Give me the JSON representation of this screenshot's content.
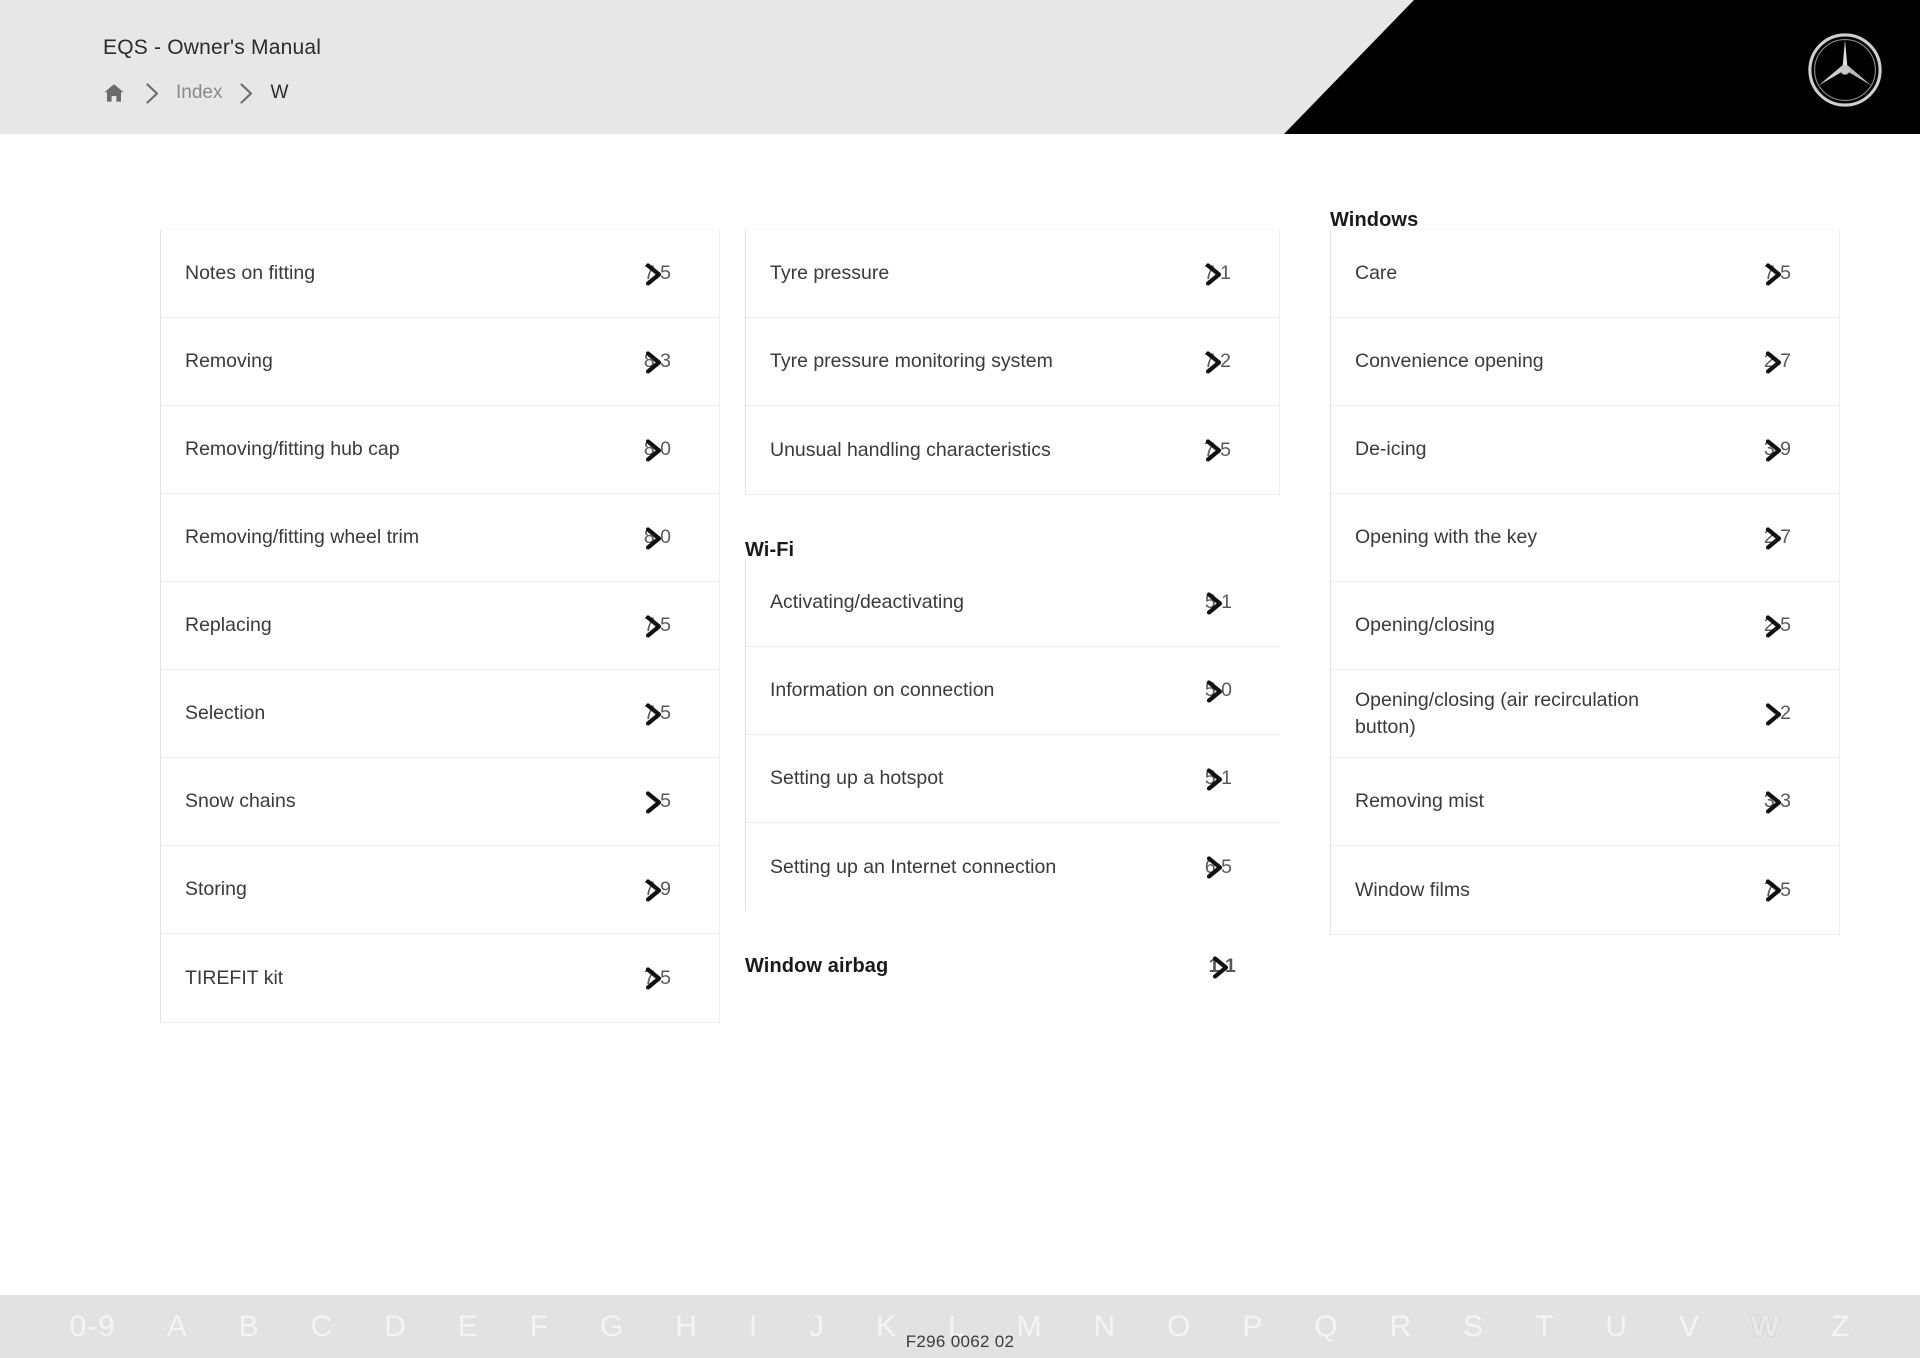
{
  "header": {
    "manual_title": "EQS - Owner's Manual",
    "breadcrumb": {
      "home_icon": "home-icon",
      "separator_icon": "chevron-right-icon",
      "index_label": "Index",
      "current_label": "W"
    },
    "brand_logo": "mercedes-benz-star-logo",
    "brand_black": "#000000",
    "header_grey": "#e7e7e7"
  },
  "index": {
    "columns": [
      {
        "heading": null,
        "entries": [
          {
            "label": "Notes on fitting",
            "page": "7 5"
          },
          {
            "label": "Removing",
            "page": "8 3"
          },
          {
            "label": "Removing/fitting hub cap",
            "page": "8 0"
          },
          {
            "label": "Removing/fitting wheel trim",
            "page": "8 0"
          },
          {
            "label": "Replacing",
            "page": "7 5"
          },
          {
            "label": "Selection",
            "page": "7 5"
          },
          {
            "label": "Snow chains",
            "page": "5"
          },
          {
            "label": "Storing",
            "page": "7 9"
          },
          {
            "label": "TIREFIT kit",
            "page": "7 5"
          }
        ]
      },
      {
        "groups": [
          {
            "heading": null,
            "heading_page": null,
            "entries": [
              {
                "label": "Tyre pressure",
                "page": "7 1"
              },
              {
                "label": "Tyre pressure monitoring system",
                "page": "7 2"
              },
              {
                "label": "Unusual handling characteristics",
                "page": "7 5"
              }
            ]
          },
          {
            "heading": "Wi-Fi",
            "heading_page": null,
            "entries": [
              {
                "label": "Activating/deactivating",
                "page": "5 1"
              },
              {
                "label": "Information on connection",
                "page": "5 0"
              },
              {
                "label": "Setting up a hotspot",
                "page": "5 1"
              },
              {
                "label": "Setting up an Internet connection",
                "page": "6 5"
              }
            ]
          },
          {
            "heading": "Window airbag",
            "heading_page": "1 1",
            "entries": []
          }
        ]
      },
      {
        "groups": [
          {
            "heading": "Windows",
            "heading_page": null,
            "entries": [
              {
                "label": "Care",
                "page": "7 5"
              },
              {
                "label": "Convenience opening",
                "page": "2 7"
              },
              {
                "label": "De-icing",
                "page": "3 9"
              },
              {
                "label": "Opening with the key",
                "page": "2 7"
              },
              {
                "label": "Opening/closing",
                "page": "2 5"
              },
              {
                "label": "Opening/closing (air recirculation button)",
                "page": "2"
              },
              {
                "label": "Removing mist",
                "page": "3 3"
              },
              {
                "label": "Window films",
                "page": "7 5"
              }
            ]
          }
        ]
      }
    ]
  },
  "alphabet_bar": {
    "items": [
      "0-9",
      "A",
      "B",
      "C",
      "D",
      "E",
      "F",
      "G",
      "H",
      "I",
      "J",
      "K",
      "L",
      "M",
      "N",
      "O",
      "P",
      "Q",
      "R",
      "S",
      "T",
      "U",
      "V",
      "W",
      "Z"
    ],
    "active": "W",
    "background": "#e2e2e2"
  },
  "footer": {
    "document_code": "F296 0062 02"
  }
}
